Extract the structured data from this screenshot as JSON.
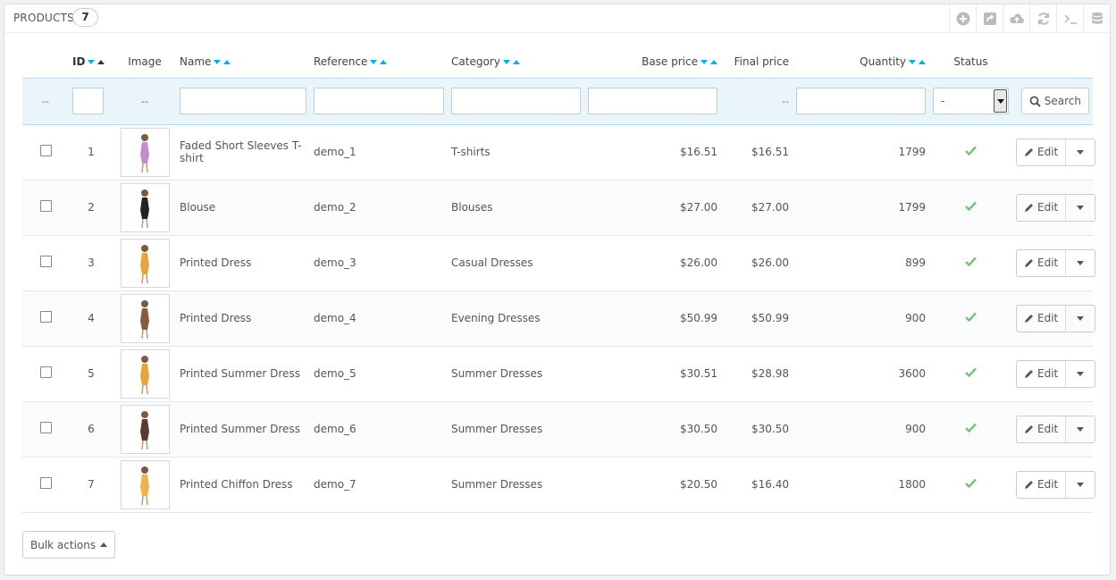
{
  "panel": {
    "title": "Products",
    "count": "7"
  },
  "toolbar": {
    "icons": [
      "add-new-icon",
      "export-icon",
      "import-icon",
      "refresh-icon",
      "sql-query-icon",
      "sql-manager-icon"
    ]
  },
  "table": {
    "headers": {
      "id": "ID",
      "image": "Image",
      "name": "Name",
      "reference": "Reference",
      "category": "Category",
      "base_price": "Base price",
      "final_price": "Final price",
      "quantity": "Quantity",
      "status": "Status"
    },
    "filter": {
      "placeholder_dash": "--",
      "status_selected": "-",
      "search_label": "Search"
    },
    "rows": [
      {
        "id": "1",
        "name": "Faded Short Sleeves T-shirt",
        "reference": "demo_1",
        "category": "T-shirts",
        "base_price": "$16.51",
        "final_price": "$16.51",
        "quantity": "1799",
        "edit": "Edit"
      },
      {
        "id": "2",
        "name": "Blouse",
        "reference": "demo_2",
        "category": "Blouses",
        "base_price": "$27.00",
        "final_price": "$27.00",
        "quantity": "1799",
        "edit": "Edit"
      },
      {
        "id": "3",
        "name": "Printed Dress",
        "reference": "demo_3",
        "category": "Casual Dresses",
        "base_price": "$26.00",
        "final_price": "$26.00",
        "quantity": "899",
        "edit": "Edit"
      },
      {
        "id": "4",
        "name": "Printed Dress",
        "reference": "demo_4",
        "category": "Evening Dresses",
        "base_price": "$50.99",
        "final_price": "$50.99",
        "quantity": "900",
        "edit": "Edit"
      },
      {
        "id": "5",
        "name": "Printed Summer Dress",
        "reference": "demo_5",
        "category": "Summer Dresses",
        "base_price": "$30.51",
        "final_price": "$28.98",
        "quantity": "3600",
        "edit": "Edit"
      },
      {
        "id": "6",
        "name": "Printed Summer Dress",
        "reference": "demo_6",
        "category": "Summer Dresses",
        "base_price": "$30.50",
        "final_price": "$30.50",
        "quantity": "900",
        "edit": "Edit"
      },
      {
        "id": "7",
        "name": "Printed Chiffon Dress",
        "reference": "demo_7",
        "category": "Summer Dresses",
        "base_price": "$20.50",
        "final_price": "$16.40",
        "quantity": "1800",
        "edit": "Edit"
      }
    ]
  },
  "bulk_actions": {
    "label": "Bulk actions"
  },
  "colors": {
    "accent": "#00aff0",
    "enabled_check": "#72c279",
    "filter_bg": "#eaf4fb"
  }
}
